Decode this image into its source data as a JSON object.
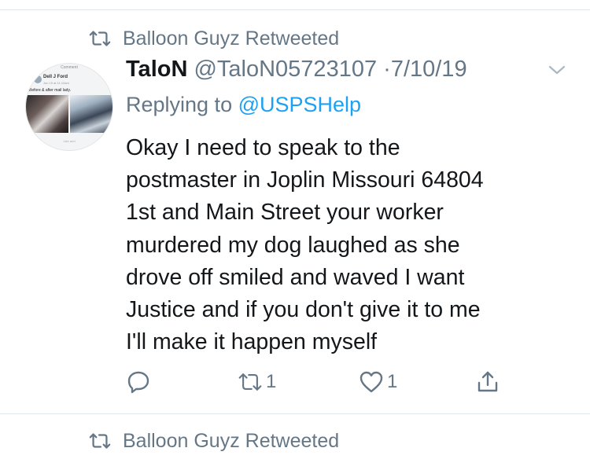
{
  "retweet_label": "Balloon Guyz Retweeted",
  "tweet": {
    "display_name": "TaloN",
    "handle": "@TaloN05723107",
    "separator": "·",
    "date": "7/10/19",
    "replying_prefix": "Replying to",
    "replying_handle": "@USPSHelp",
    "text_lines": [
      "Okay I need to speak to the",
      "postmaster in Joplin Missouri 64804",
      "1st and Main Street your worker",
      "murdered my dog laughed as she",
      "drove off smiled and waved I want",
      "Justice and if you don't give it to me",
      "I'll make it happen myself"
    ],
    "reply_count": "",
    "retweet_count": "1",
    "like_count": "1"
  },
  "avatar": {
    "top_text": "Comment",
    "name": "Dell J Ford",
    "date": "Jun 19 at 11:12am",
    "caption": "Before & after mail lady.",
    "bottom_text": "Like and"
  },
  "next_tweet": {
    "retweet_label": "Balloon Guyz Retweeted"
  },
  "icons": {
    "retweet": "retweet-icon",
    "reply": "reply-icon",
    "like": "heart-icon",
    "share": "share-icon",
    "more": "chevron-down-icon"
  },
  "colors": {
    "text": "#14171a",
    "secondary": "#657786",
    "link": "#1da1f2",
    "divider": "#e1e8ed"
  }
}
